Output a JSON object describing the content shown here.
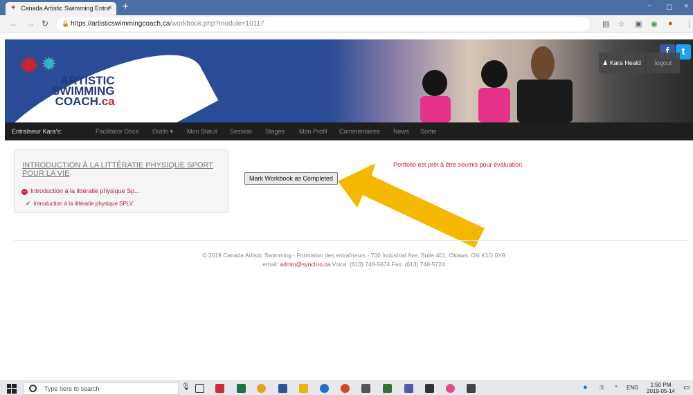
{
  "browser": {
    "tab_title": "Canada Artistic Swimming Entra",
    "tab_close": "×",
    "new_tab": "+",
    "url_host": "https://artisticswimmingcoach.ca",
    "url_path": "/workbook.php?module=10117",
    "window_controls": [
      "−",
      "◻",
      "×"
    ]
  },
  "banner": {
    "logo_line1": "ARTISTIC",
    "logo_line2": "SWIMMING",
    "logo_line3": "COACH.",
    "logo_suffix": "ca",
    "facebook": "f",
    "twitter": "t",
    "user_name": "Kara Heald",
    "logout": "logout"
  },
  "nav": {
    "items": [
      "Entraîneur Kara's:",
      "Facilitator Docs",
      "Outils ▾",
      "Mon Statut",
      "Session",
      "Stages",
      "Mon Profil",
      "Commentaires",
      "News",
      "Sortie"
    ]
  },
  "content": {
    "card_title": "INTRODUCTION À LA LITTÉRATIE PHYSIQUE SPORT POUR LA VIE",
    "item_incomplete": "Introduction à la littératie physique Sp...",
    "item_complete": "Introduction à la littératie physique SPLV",
    "mark_button": "Mark Workbook as Completed",
    "ready_message": "Portfolio est prêt à être soumis pour évaluation.",
    "arrow_color": "#f5b800"
  },
  "footer": {
    "line1": "© 2019 Canada Artistic Swimming - Formation des entraîneurs - 700 Industrial Ave. Suite 401, Ottawa, ON K1G 0Y9",
    "email_label": "email:",
    "email": "admin@synchro.ca",
    "phones": "Voice: (613) 748-5674 Fax: (613) 748-5724"
  },
  "taskbar": {
    "search_placeholder": "Type here to search",
    "language": "ENG",
    "time": "1:50 PM",
    "date": "2019-05-14"
  }
}
